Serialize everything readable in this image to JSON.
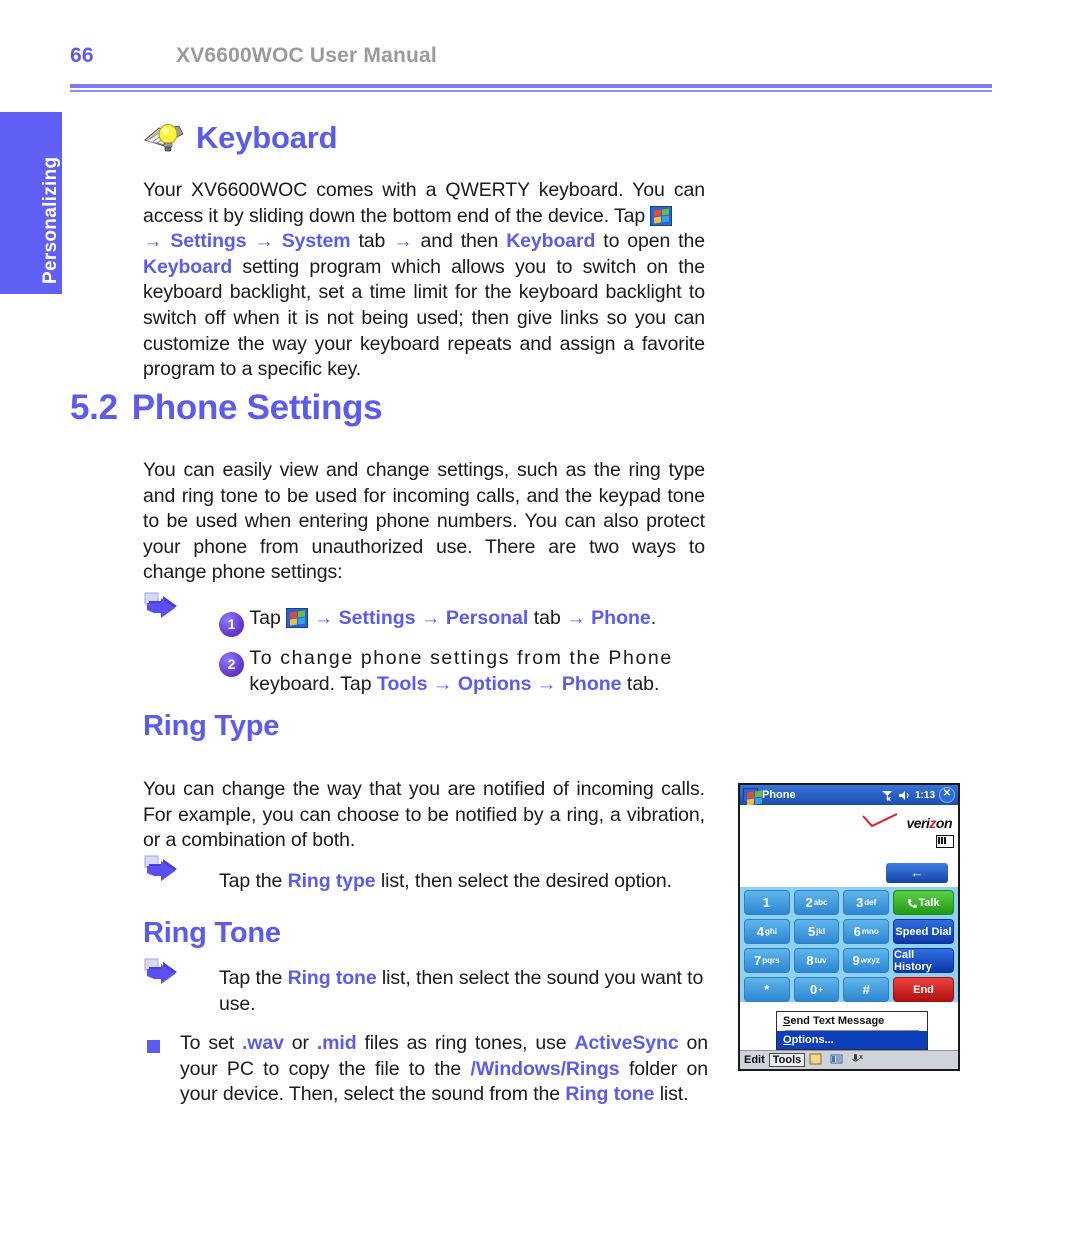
{
  "header": {
    "page_number": "66",
    "manual_title": "XV6600WOC User Manual"
  },
  "side_tab": {
    "label": "Personalizing"
  },
  "keyboard_section": {
    "heading": "Keyboard",
    "icon": "keyboard-bulb-icon",
    "paragraph_1": "Your XV6600WOC comes with a QWERTY keyboard. You can access it by sliding down the bottom end of the device. Tap ",
    "arrow": "→",
    "link_settings": "Settings",
    "link_system": "System",
    "word_tab": " tab ",
    "and_then": " and then ",
    "link_keyboard": "Keyboard",
    "to_open_the": " to open the ",
    "link_keyboard_2": "Keyboard",
    "paragraph_2": " setting program which allows you to switch on the keyboard backlight, set a time limit for the keyboard backlight to switch off when it is not being used; then give links so you can customize the way your keyboard repeats and assign a favorite program to a specific key."
  },
  "section": {
    "number": "5.2",
    "title": "Phone Settings",
    "intro": "You can easily view and change settings, such as the ring type and ring tone to be used for incoming calls, and the keypad tone to be used when entering phone numbers. You can also protect your phone from unauthorized use. There are two ways to change phone settings:"
  },
  "steps": [
    {
      "number": "1",
      "prefix": "Tap ",
      "arrow1": "→",
      "settings": "Settings",
      "arrow2": "→",
      "personal": "Personal",
      "tab_word": " tab ",
      "arrow3": "→",
      "phone": "Phone",
      "period": "."
    },
    {
      "number": "2",
      "line1": "To change phone settings from the Phone",
      "line2_prefix": "keyboard. Tap ",
      "tools": "Tools",
      "arrow1": "→",
      "options": "Options",
      "arrow2": "→",
      "phone": "Phone",
      "tab_word": " tab."
    }
  ],
  "ring_type": {
    "heading": "Ring Type",
    "body": "You can change the way that you are notified of incoming calls. For example, you can choose to be notified by a ring, a vibration, or a combination of both.",
    "tip_prefix": "Tap the ",
    "tip_link": "Ring type",
    "tip_suffix": " list, then select the desired option."
  },
  "ring_tone": {
    "heading": "Ring Tone",
    "tip_prefix": "Tap the ",
    "tip_link": "Ring tone",
    "tip_suffix": " list, then select the sound you want to use.",
    "note_1": "To set ",
    "note_wav": ".wav",
    "note_or": " or ",
    "note_mid": ".mid",
    "note_2": " files as ring tones, use ",
    "note_activesync": "ActiveSync",
    "note_3": " on your PC to copy the file to the ",
    "note_path": "/Windows/Rings",
    "note_4": " folder on your device. Then, select the sound from the ",
    "note_ringtone": "Ring tone",
    "note_5": " list."
  },
  "screenshot": {
    "title_bar": {
      "app": "Phone",
      "time": "1:13",
      "signal_icon": "signal-no-service-icon",
      "volume_icon": "speaker-icon",
      "close_icon": "close-icon"
    },
    "carrier": "verizon",
    "back_button": "←",
    "keypad": [
      [
        {
          "digit": "1",
          "letters": ""
        },
        {
          "digit": "2",
          "letters": "abc"
        },
        {
          "digit": "3",
          "letters": "def"
        },
        {
          "digit": "",
          "letters": "",
          "label": "Talk",
          "style": "green"
        }
      ],
      [
        {
          "digit": "4",
          "letters": "ghi"
        },
        {
          "digit": "5",
          "letters": "jkl"
        },
        {
          "digit": "6",
          "letters": "mno"
        },
        {
          "digit": "",
          "letters": "",
          "label": "Speed Dial",
          "style": "blue"
        }
      ],
      [
        {
          "digit": "7",
          "letters": "pqrs"
        },
        {
          "digit": "8",
          "letters": "tuv"
        },
        {
          "digit": "9",
          "letters": "wxyz"
        },
        {
          "digit": "",
          "letters": "",
          "label": "Call History",
          "style": "blue"
        }
      ],
      [
        {
          "digit": "*",
          "letters": ""
        },
        {
          "digit": "0",
          "letters": "+"
        },
        {
          "digit": "#",
          "letters": ""
        },
        {
          "digit": "",
          "letters": "",
          "label": "End",
          "style": "red"
        }
      ]
    ],
    "popup_menu": {
      "item_1": "Send Text Message",
      "item_2": "Options..."
    },
    "footer": {
      "edit": "Edit",
      "tools": "Tools"
    }
  },
  "colors": {
    "accent_blue": "#5b5bf0",
    "header_gray": "#9a9a9a",
    "tab_blue": "#6060f7",
    "body_text": "#1a1a1a"
  }
}
